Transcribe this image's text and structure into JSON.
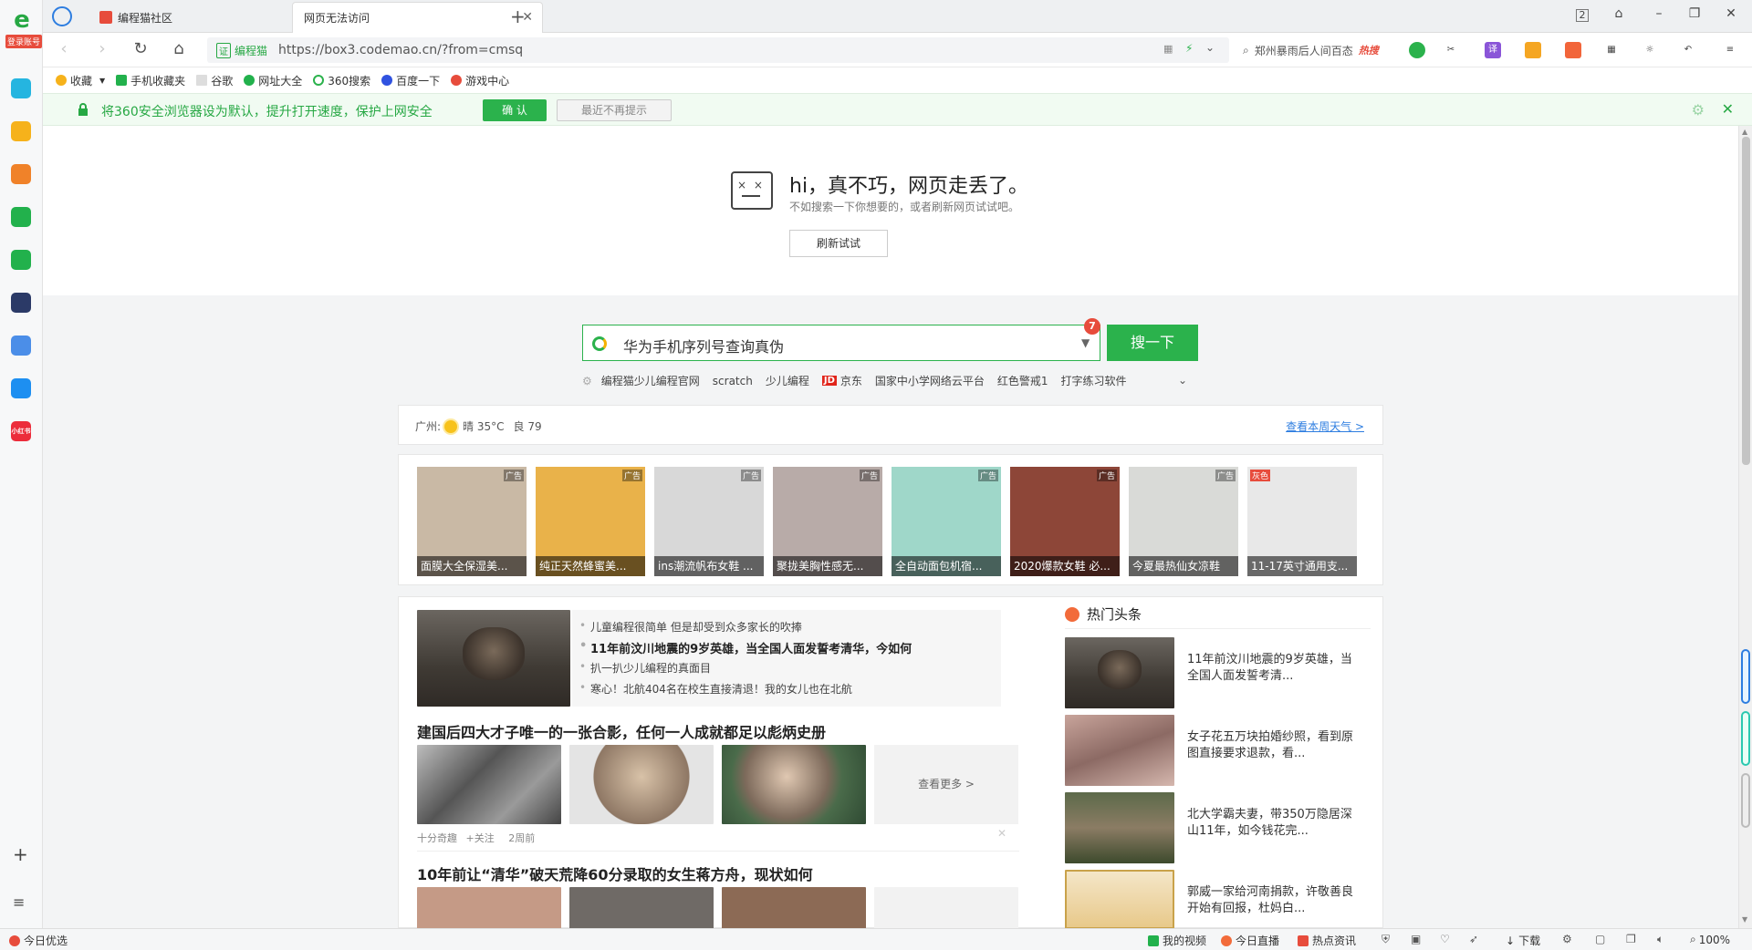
{
  "sidebar": {
    "login_label": "登录账号",
    "apps": [
      {
        "icon": "add-app-icon",
        "color": "#25b5e0"
      },
      {
        "icon": "star-icon",
        "color": "#f6b21b"
      },
      {
        "icon": "weibo-icon",
        "color": "#f08229"
      },
      {
        "icon": "mail-icon",
        "color": "#22b14c"
      },
      {
        "icon": "cloud-icon",
        "color": "#22b14c"
      },
      {
        "icon": "news-icon",
        "color": "#2b3a67"
      },
      {
        "icon": "doc-icon",
        "color": "#4b8ee8"
      },
      {
        "icon": "p-icon",
        "color": "#1d8ff1"
      },
      {
        "icon": "xiaohongshu-icon",
        "color": "#ec2c3b",
        "label": "小红书"
      }
    ]
  },
  "tabs": [
    {
      "label": "编程猫社区",
      "active": false
    },
    {
      "label": "网页无法访问",
      "active": true
    }
  ],
  "toolbar": {
    "secure_tag": "证",
    "secure_label": "编程猫",
    "url": "https://box3.codemao.cn/?from=cmsq",
    "hot_search": "郑州暴雨后人间百态",
    "hot_tag": "热搜"
  },
  "bookmarks": [
    {
      "label": "收藏",
      "color": "#f6b21b"
    },
    {
      "label": "手机收藏夹",
      "color": "#22b14c"
    },
    {
      "label": "谷歌",
      "color": "#888888"
    },
    {
      "label": "网址大全",
      "color": "#22b14c"
    },
    {
      "label": "360搜索",
      "color": "#2bb24c"
    },
    {
      "label": "百度一下",
      "color": "#3052e0"
    },
    {
      "label": "游戏中心",
      "color": "#e74c3c"
    }
  ],
  "notice": {
    "text": "将360安全浏览器设为默认，提升打开速度，保护上网安全",
    "confirm": "确 认",
    "later": "最近不再提示"
  },
  "error": {
    "title": "hi，真不巧，网页走丢了。",
    "subtitle": "不如搜索一下你想要的，或者刷新网页试试吧。",
    "refresh": "刷新试试"
  },
  "search": {
    "query": "华为手机序列号查询真伪",
    "badge": "7",
    "button": "搜一下",
    "quicklinks": [
      "编程猫少儿编程官网",
      "scratch",
      "少儿编程",
      "京东",
      "国家中小学网络云平台",
      "红色警戒1",
      "打字练习软件"
    ],
    "jd_tag": "JD"
  },
  "weather": {
    "city": "广州:",
    "condition": "晴 35°C",
    "aqi": "良 79",
    "link": "查看本周天气 >"
  },
  "ads": [
    {
      "caption": "面膜大全保湿美...",
      "tag": "广告",
      "bg": "#c9b9a5"
    },
    {
      "caption": "纯正天然蜂蜜美...",
      "tag": "广告",
      "bg": "#e9b24a"
    },
    {
      "caption": "ins潮流帆布女鞋 ...",
      "tag": "广告",
      "bg": "#d8d8d8"
    },
    {
      "caption": "聚拢美胸性感无...",
      "tag": "广告",
      "bg": "#b8aba8"
    },
    {
      "caption": "全自动面包机宿...",
      "tag": "广告",
      "bg": "#9fd7c9"
    },
    {
      "caption": "2020爆款女鞋 必...",
      "tag": "广告",
      "bg": "#8d4638"
    },
    {
      "caption": "今夏最热仙女凉鞋",
      "tag": "广告",
      "bg": "#d9dad7"
    },
    {
      "caption": "11-17英寸通用支...",
      "tag": "灰色",
      "bg": "#e8e8e8"
    }
  ],
  "news": {
    "bullets": [
      {
        "text": "儿童编程很简单 但是却受到众多家长的吹捧",
        "bold": false
      },
      {
        "text": "11年前汶川地震的9岁英雄，当全国人面发誓考清华，今如何",
        "bold": true
      },
      {
        "text": "扒一扒少儿编程的真面目",
        "bold": false
      },
      {
        "text": "寒心！北航404名在校生直接清退！我的女儿也在北航",
        "bold": false
      }
    ],
    "article1_title": "建国后四大才子唯一的一张合影，任何一人成就都足以彪炳史册",
    "more": "查看更多 >",
    "meta_source": "十分奇趣",
    "meta_follow": "+关注",
    "meta_time": "2周前",
    "article2_title": "10年前让“清华”破天荒降60分录取的女生蒋方舟，现状如何"
  },
  "hot": {
    "title": "热门头条",
    "items": [
      "11年前汶川地震的9岁英雄，当全国人面发誓考清...",
      "女子花五万块拍婚纱照，看到原图直接要求退款，看...",
      "北大学霸夫妻，带350万隐居深山11年，如今钱花完...",
      "郭威一家给河南捐款，许敬善良开始有回报，杜妈白..."
    ]
  },
  "statusbar": {
    "left": "今日优选",
    "video": "我的视频",
    "live": "今日直播",
    "hotnews": "热点资讯",
    "download": "下载",
    "zoom": "100%"
  }
}
